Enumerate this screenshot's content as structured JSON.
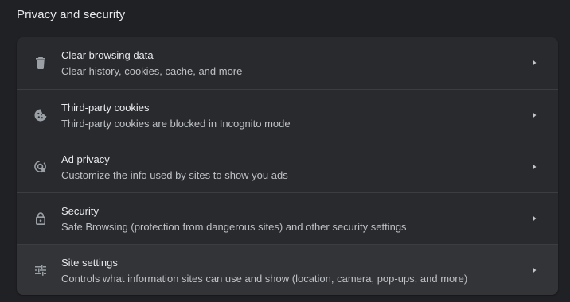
{
  "section": {
    "title": "Privacy and security"
  },
  "items": [
    {
      "icon": "trash-icon",
      "title": "Clear browsing data",
      "subtitle": "Clear history, cookies, cache, and more"
    },
    {
      "icon": "cookie-icon",
      "title": "Third-party cookies",
      "subtitle": "Third-party cookies are blocked in Incognito mode"
    },
    {
      "icon": "ad-privacy-icon",
      "title": "Ad privacy",
      "subtitle": "Customize the info used by sites to show you ads"
    },
    {
      "icon": "lock-icon",
      "title": "Security",
      "subtitle": "Safe Browsing (protection from dangerous sites) and other security settings"
    },
    {
      "icon": "tune-sliders-icon",
      "title": "Site settings",
      "subtitle": "Controls what information sites can use and show (location, camera, pop-ups, and more)"
    }
  ],
  "colors": {
    "background": "#202124",
    "card": "#292a2d",
    "hover_row": "#333437",
    "divider": "#3c3d40",
    "text_primary": "#e8eaed",
    "text_secondary": "#bdc1c6",
    "icon": "#9aa0a6"
  }
}
